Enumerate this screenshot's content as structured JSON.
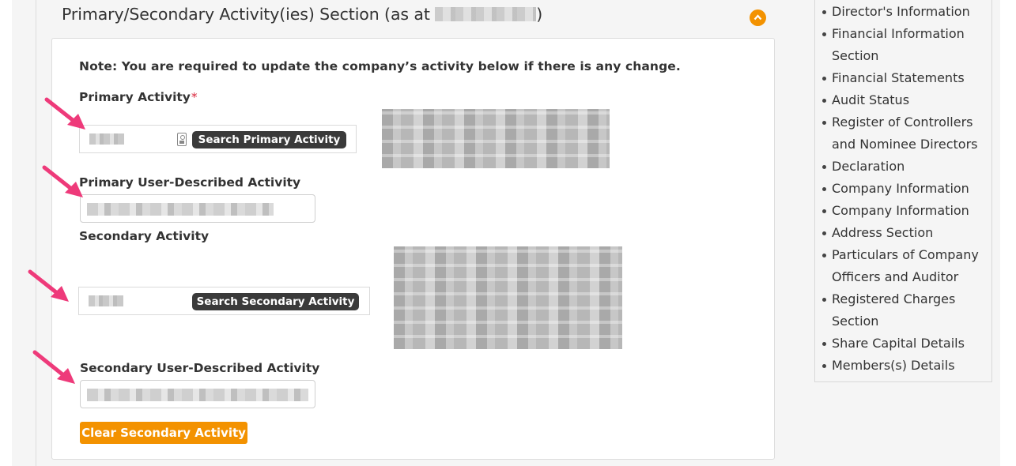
{
  "section": {
    "title": "Primary/Secondary Activity(ies) Section (as at",
    "title_close": ")",
    "collapse_icon": "chevron-up-icon",
    "accent_color": "#f39200"
  },
  "form": {
    "note": "Note: You are required to update the company’s activity below if there is any change.",
    "primary_activity_label": "Primary Activity",
    "required_mark": "*",
    "search_primary_label": "Search Primary Activity",
    "primary_user_label": "Primary User-Described Activity",
    "secondary_activity_label": "Secondary Activity",
    "search_secondary_label": "Search Secondary Activity",
    "secondary_user_label": "Secondary User-Described Activity",
    "clear_secondary_label": "Clear Secondary Activity"
  },
  "sidebar": {
    "items": [
      {
        "label": "Director's Information"
      },
      {
        "label": "Financial Information Section"
      },
      {
        "label": "Financial Statements"
      },
      {
        "label": "Audit Status"
      },
      {
        "label": "Register of Controllers and Nominee Directors"
      },
      {
        "label": "Declaration"
      },
      {
        "label": "Company Information"
      },
      {
        "label": "Company Information"
      },
      {
        "label": "Address Section"
      },
      {
        "label": "Particulars of Company Officers and Auditor"
      },
      {
        "label": "Registered Charges Section"
      },
      {
        "label": "Share Capital Details"
      },
      {
        "label": "Members(s) Details"
      }
    ]
  },
  "annotations": {
    "arrow_color": "#ee3a7a"
  }
}
